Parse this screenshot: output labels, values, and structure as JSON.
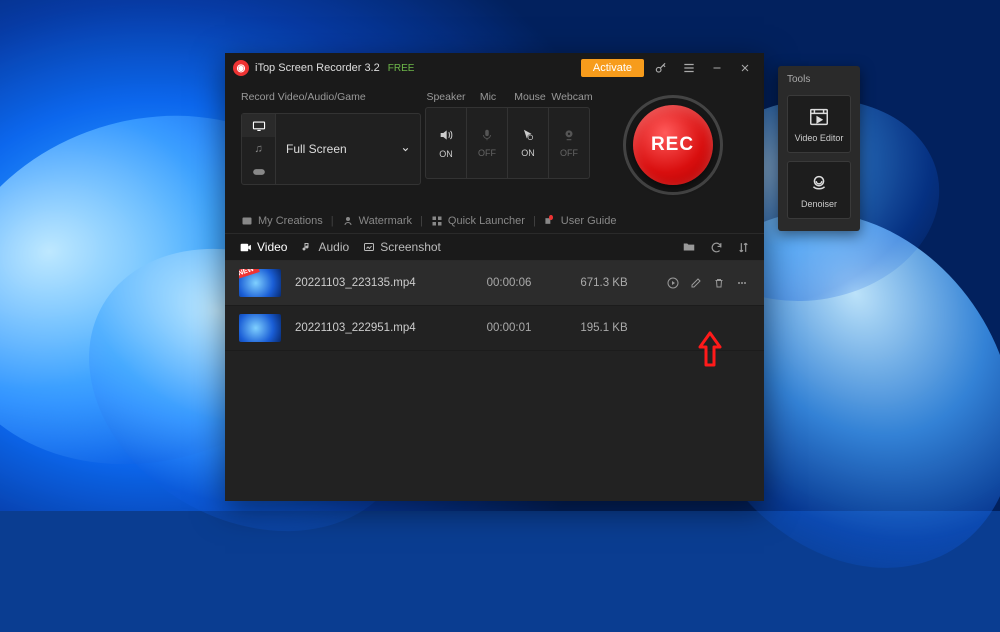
{
  "titlebar": {
    "app_name": "iTop Screen Recorder 3.2",
    "free_tag": "FREE",
    "activate": "Activate"
  },
  "config": {
    "section_label": "Record Video/Audio/Game",
    "mode_selected": "Full Screen",
    "toggles": {
      "speaker": {
        "label": "Speaker",
        "state": "ON"
      },
      "mic": {
        "label": "Mic",
        "state": "OFF"
      },
      "mouse": {
        "label": "Mouse",
        "state": "ON"
      },
      "webcam": {
        "label": "Webcam",
        "state": "OFF"
      }
    },
    "rec_label": "REC"
  },
  "nav": {
    "my_creations": "My Creations",
    "watermark": "Watermark",
    "quick_launcher": "Quick Launcher",
    "user_guide": "User Guide"
  },
  "tabs": {
    "video": "Video",
    "audio": "Audio",
    "screenshot": "Screenshot"
  },
  "files": [
    {
      "name": "20221103_223135.mp4",
      "duration": "00:00:06",
      "size": "671.3 KB",
      "new": true
    },
    {
      "name": "20221103_222951.mp4",
      "duration": "00:00:01",
      "size": "195.1 KB",
      "new": false
    }
  ],
  "tools": {
    "title": "Tools",
    "video_editor": "Video Editor",
    "denoiser": "Denoiser"
  }
}
